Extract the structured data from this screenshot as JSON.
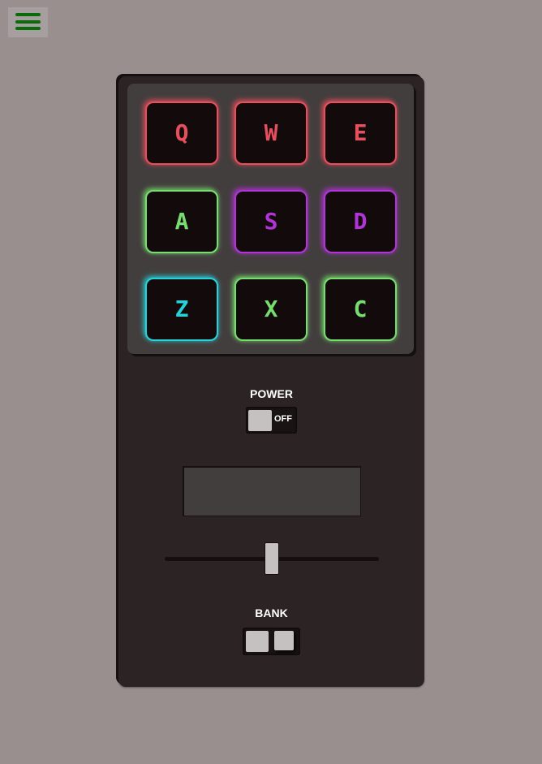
{
  "menu": {
    "icon": "hamburger-menu-icon"
  },
  "pads": [
    {
      "key": "Q",
      "color": "#e84f5d"
    },
    {
      "key": "W",
      "color": "#e84f5d"
    },
    {
      "key": "E",
      "color": "#e84f5d"
    },
    {
      "key": "A",
      "color": "#76dd6e"
    },
    {
      "key": "S",
      "color": "#b234d8"
    },
    {
      "key": "D",
      "color": "#b234d8"
    },
    {
      "key": "Z",
      "color": "#27d3db"
    },
    {
      "key": "X",
      "color": "#76dd6e"
    },
    {
      "key": "C",
      "color": "#76dd6e"
    }
  ],
  "power": {
    "label": "POWER",
    "state": "OFF"
  },
  "display": {
    "text": ""
  },
  "volume": {
    "level": 0.5
  },
  "bank": {
    "label": "BANK"
  },
  "colors": {
    "background": "#998f8f",
    "machine": "#2c2424",
    "pad_area": "#433e3e",
    "menu_icon": "#0a6b0a"
  }
}
